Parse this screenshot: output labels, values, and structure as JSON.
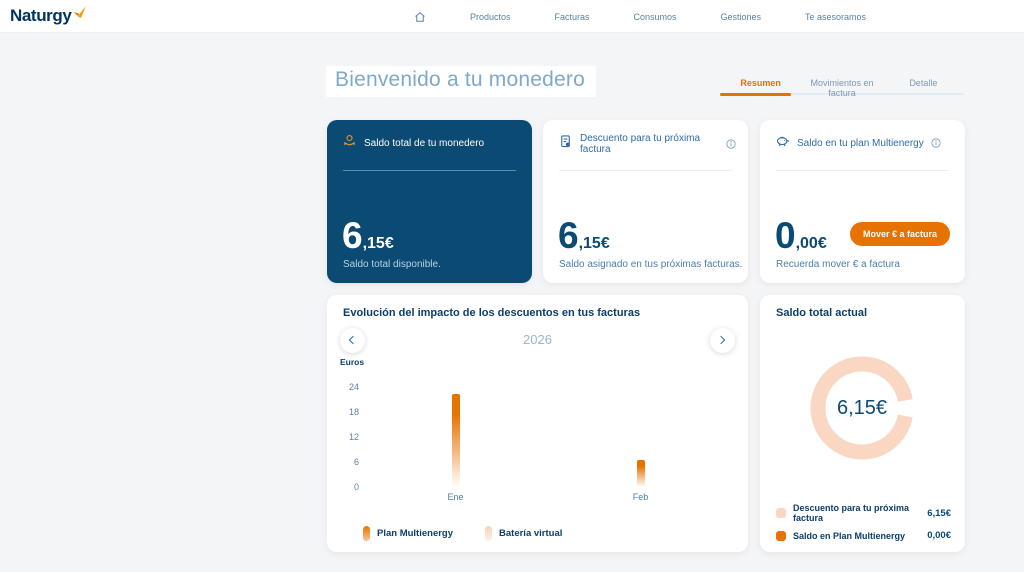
{
  "theme": {
    "brand_orange": "#e87200",
    "brand_navy": "#00345c",
    "dark_card_blue": "#0a4a73",
    "link_blue": "#2e6da6",
    "page_bg": "#f4f5f7",
    "donut_peach": "#f9d7c2"
  },
  "header": {
    "logo_text": "Naturgy",
    "nav_items": [
      "Productos",
      "Facturas",
      "Consumos",
      "Gestiones",
      "Te asesoramos"
    ]
  },
  "page": {
    "title": "Bienvenido a tu monedero"
  },
  "tabs": [
    {
      "label": "Resumen",
      "active": true
    },
    {
      "label": "Movimientos en factura",
      "active": false
    },
    {
      "label": "Detalle",
      "active": false
    }
  ],
  "cards": [
    {
      "title": "Saldo total de tu monedero",
      "icon": "coin-hand-icon",
      "amount_int": "6",
      "amount_frac": ",15€",
      "subtitle": "Saldo total disponible."
    },
    {
      "title": "Descuento para tu próxima factura",
      "icon": "invoice-icon",
      "amount_int": "6",
      "amount_frac": ",15€",
      "subtitle": "Saldo asignado en tus próximas facturas."
    },
    {
      "title": "Saldo en tu plan Multienergy",
      "icon": "piggy-bank-icon",
      "amount_int": "0",
      "amount_frac": ",00€",
      "subtitle": "Recuerda mover € a factura",
      "button_label": "Mover € a factura"
    }
  ],
  "chart_data": [
    {
      "type": "bar",
      "title": "Evolución del impacto de los descuentos en tus facturas",
      "period_label": "2026",
      "ylabel": "Euros",
      "ylim": [
        0,
        24
      ],
      "yticks": [
        24,
        18,
        12,
        6,
        0
      ],
      "categories": [
        "Ene",
        "Feb"
      ],
      "series": [
        {
          "name": "Plan Multienergy",
          "values": [
            22.3,
            6.5
          ],
          "color": "#e87200",
          "legend_fade": "#f8c495"
        },
        {
          "name": "Batería virtual",
          "values": [
            0,
            0
          ],
          "color": "#f6d4bc",
          "legend_fade": "#fdf0e6"
        }
      ],
      "legend_position": "bottom",
      "grid": false
    },
    {
      "type": "pie",
      "title": "Saldo total actual",
      "center_label": "6,15€",
      "slices": [
        {
          "label": "Descuento para tu próxima factura",
          "value": 6.15,
          "display_value": "6,15€",
          "color": "#f9d7c2"
        },
        {
          "label": "Saldo en Plan Multienergy",
          "value": 0.0,
          "display_value": "0,00€",
          "color": "#e87200"
        }
      ]
    }
  ]
}
